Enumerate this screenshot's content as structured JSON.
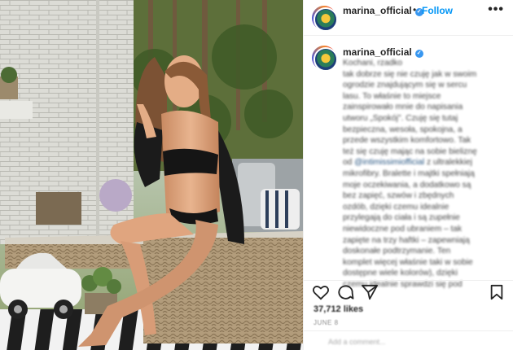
{
  "post": {
    "username": "marina_official",
    "verified_mark": "✓",
    "separator": "•",
    "follow_label": "Follow",
    "more_label": "•••"
  },
  "caption": {
    "username": "marina_official",
    "lines": [
      "Kochani, rzadko",
      "tak dobrze się nie czuję jak w swoim",
      "ogrodzie znajdującym się w sercu",
      "lasu. To właśnie to miejsce",
      "zainspirowało mnie do napisania",
      "utworu „Spokój\". Czuję się tutaj",
      "bezpieczna, wesoła, spokojna, a",
      "przede wszystkim komfortowo. Tak",
      "też się czuję mając na sobie bieliznę",
      "od @intimissimiofficial z ultralekkiej",
      "mikrofibry. Bralette i majtki spełniają",
      "moje oczekiwania, a dodatkowo są",
      "bez zapięć, szwów i zbędnych",
      "ozdób, dzięki czemu idealnie",
      "przylegają do ciała i są zupełnie",
      "niewidoczne pod ubraniem – tak",
      "zapięte na trzy haftki – zapewniają",
      "doskonałe podtrzymanie. Ten",
      "komplet więcej właśnie taki w sobie",
      "dostępne wiele kolorów), dzięki",
      "czemu idealnie sprawdzi się pod"
    ],
    "mention": "@intimissimiofficial"
  },
  "actions": {
    "likes": "37,712 likes",
    "date": "JUNE 8",
    "comment_hint": "Add a comment..."
  },
  "icons": [
    "heart-icon",
    "comment-icon",
    "share-icon",
    "save-icon",
    "more-icon",
    "verified-icon"
  ],
  "colors": {
    "accent": "#0095f6",
    "verified": "#3897f0",
    "text": "#262626",
    "muted": "#8e8e8e"
  }
}
